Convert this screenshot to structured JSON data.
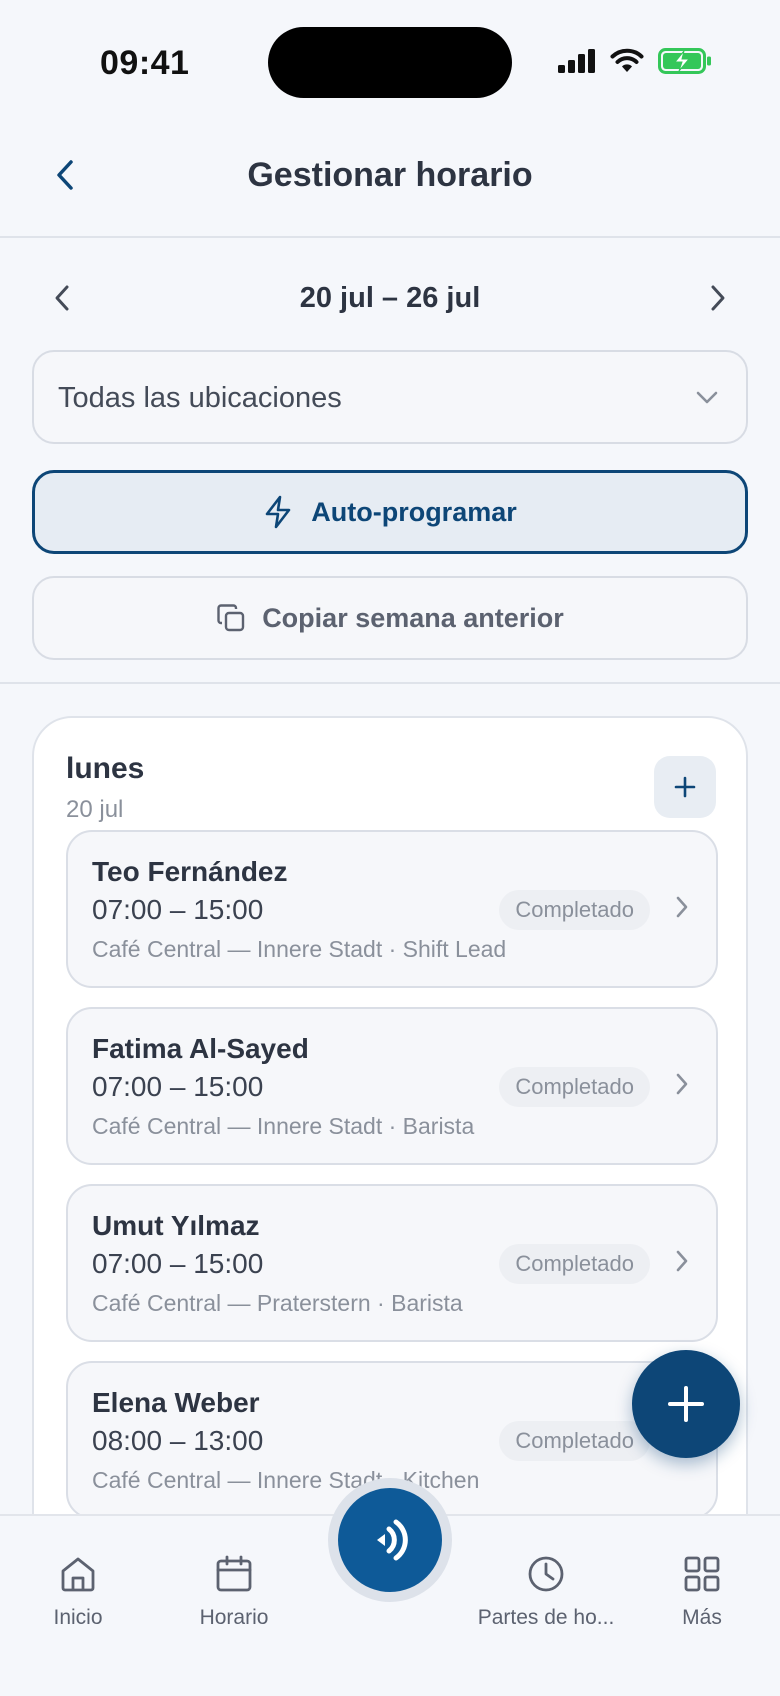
{
  "status_bar": {
    "time": "09:41"
  },
  "header": {
    "title": "Gestionar horario"
  },
  "week": {
    "label": "20 jul – 26 jul"
  },
  "location_select": {
    "selected": "Todas las ubicaciones"
  },
  "actions": {
    "auto_schedule": "Auto-programar",
    "copy_week": "Copiar semana anterior"
  },
  "day": {
    "name": "lunes",
    "date": "20 jul",
    "shifts": [
      {
        "name": "Teo Fernández",
        "time": "07:00 – 15:00",
        "meta": "Café Central — Innere Stadt · Shift Lead",
        "status": "Completado"
      },
      {
        "name": "Fatima Al-Sayed",
        "time": "07:00 – 15:00",
        "meta": "Café Central — Innere Stadt · Barista",
        "status": "Completado"
      },
      {
        "name": "Umut Yılmaz",
        "time": "07:00 – 15:00",
        "meta": "Café Central — Praterstern · Barista",
        "status": "Completado"
      },
      {
        "name": "Elena Weber",
        "time": "08:00 – 13:00",
        "meta": "Café Central — Innere Stadt · Kitchen",
        "status": "Completado"
      }
    ]
  },
  "tab_bar": {
    "items": [
      {
        "label": "Inicio",
        "icon": "home-icon"
      },
      {
        "label": "Horario",
        "icon": "calendar-icon"
      },
      {
        "label": "Partes de ho...",
        "icon": "clock-icon"
      },
      {
        "label": "Más",
        "icon": "grid-icon"
      }
    ]
  },
  "colors": {
    "primary": "#0d4677",
    "accent": "#0e5a98",
    "battery": "#34c759"
  }
}
